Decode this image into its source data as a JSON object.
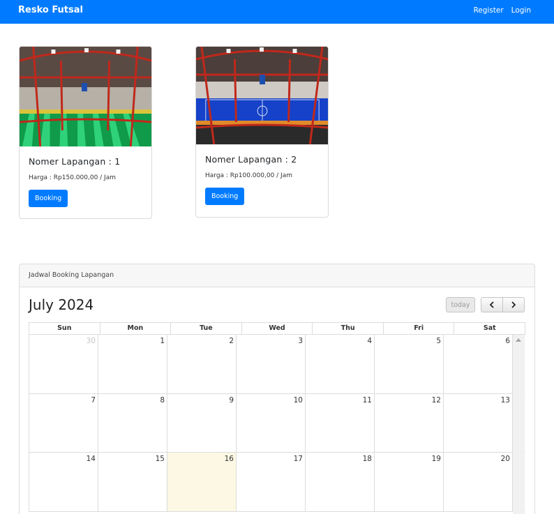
{
  "navbar": {
    "brand": "Resko Futsal",
    "links": [
      "Register",
      "Login"
    ]
  },
  "fields": [
    {
      "title": "Nomer Lapangan : 1",
      "price": "Harga : Rp150.000,00 / Jam",
      "button": "Booking",
      "image": "futsal-court-green-photo"
    },
    {
      "title": "Nomer Lapangan : 2",
      "price": "Harga : Rp100.000,00 / Jam",
      "button": "Booking",
      "image": "futsal-court-blue-photo"
    }
  ],
  "schedule": {
    "header": "Jadwal Booking Lapangan",
    "month_title": "July 2024",
    "today_label": "today",
    "prev_icon": "chevron-left-icon",
    "next_icon": "chevron-right-icon",
    "weekdays": [
      "Sun",
      "Mon",
      "Tue",
      "Wed",
      "Thu",
      "Fri",
      "Sat"
    ],
    "weeks": [
      [
        "30",
        "1",
        "2",
        "3",
        "4",
        "5",
        "6"
      ],
      [
        "7",
        "8",
        "9",
        "10",
        "11",
        "12",
        "13"
      ],
      [
        "14",
        "15",
        "16",
        "17",
        "18",
        "19",
        "20"
      ]
    ],
    "today": "16"
  },
  "colors": {
    "primary": "#007bff",
    "today_bg": "#fcf8e3"
  }
}
